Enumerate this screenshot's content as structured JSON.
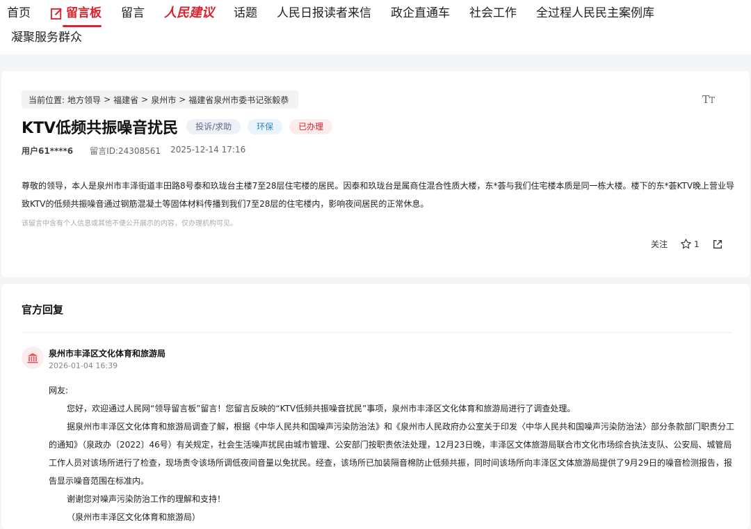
{
  "nav": {
    "row1": [
      "首页",
      "留言板",
      "留言",
      "人民建议",
      "话题",
      "人民日报读者来信",
      "政企直通车",
      "社会工作",
      "全过程人民民主案例库"
    ],
    "row2": [
      "凝聚服务群众"
    ]
  },
  "breadcrumb": {
    "prefix": "当前位置:",
    "items": [
      "地方领导",
      "福建省",
      "泉州市",
      "福建省泉州市委书记张毅恭"
    ],
    "separator": ">"
  },
  "font_button": {
    "big": "T",
    "small": "T"
  },
  "message": {
    "title": "KTV低频共振噪音扰民",
    "tags": [
      "投诉/求助",
      "环保",
      "已办理"
    ],
    "user": "用户61****6",
    "id": "留言ID:24308561",
    "time": "2025-12-14 17:16",
    "content": "尊敬的领导，本人是泉州市丰泽街道丰田路8号泰和玖珑台主楼7至28层住宅楼的居民。因泰和玖珑台是属商住混合性质大楼，东*荟与我们住宅楼本质是同一栋大楼。楼下的东*荟KTV晚上营业导致KTV的低频共振噪音通过钢筋混凝土等固体材料传播到我们7至28层的住宅楼内，影响夜间居民的正常休息。",
    "notice": "该留言中含有个人信息或其他不便公开展示的内容，仅办理机构可见。"
  },
  "actions": {
    "follow": "关注",
    "star_count": "1"
  },
  "reply": {
    "section_title": "官方回复",
    "org": "泉州市丰泽区文化体育和旅游局",
    "time": "2026-01-04 16:39",
    "greeting": "网友:",
    "p1": "您好，欢迎通过人民网“领导留言板”留言！您留言反映的“KTV低频共振噪音扰民”事项，泉州市丰泽区文化体育和旅游局进行了调查处理。",
    "p2": "据泉州市丰泽区文化体育和旅游局调查了解，根据《中华人民共和国噪声污染防治法》和《泉州市人民政府办公室关于印发〈中华人民共和国噪声污染防治法〉部分条款部门职责分工的通知》（泉政办〔2022〕46号）有关规定，社会生活噪声扰民由城市管理、公安部门按职责依法处理，12月23日晚，丰泽区文体旅游局联合市文化市场综合执法支队、公安局、城管局工作人员对该场所进行了检查，现场责令该场所调低夜间音量以免扰民。经查，该场所已加装隔音棉防止低频共振，同时间该场所向丰泽区文体旅游局提供了9月29日的噪音检测报告，报告显示噪音范围在标准内。",
    "p3": "谢谢您对噪声污染防治工作的理解和支持！",
    "p4": "（泉州市丰泽区文化体育和旅游局）"
  },
  "colors": {
    "brand_red": "#d9232d"
  }
}
